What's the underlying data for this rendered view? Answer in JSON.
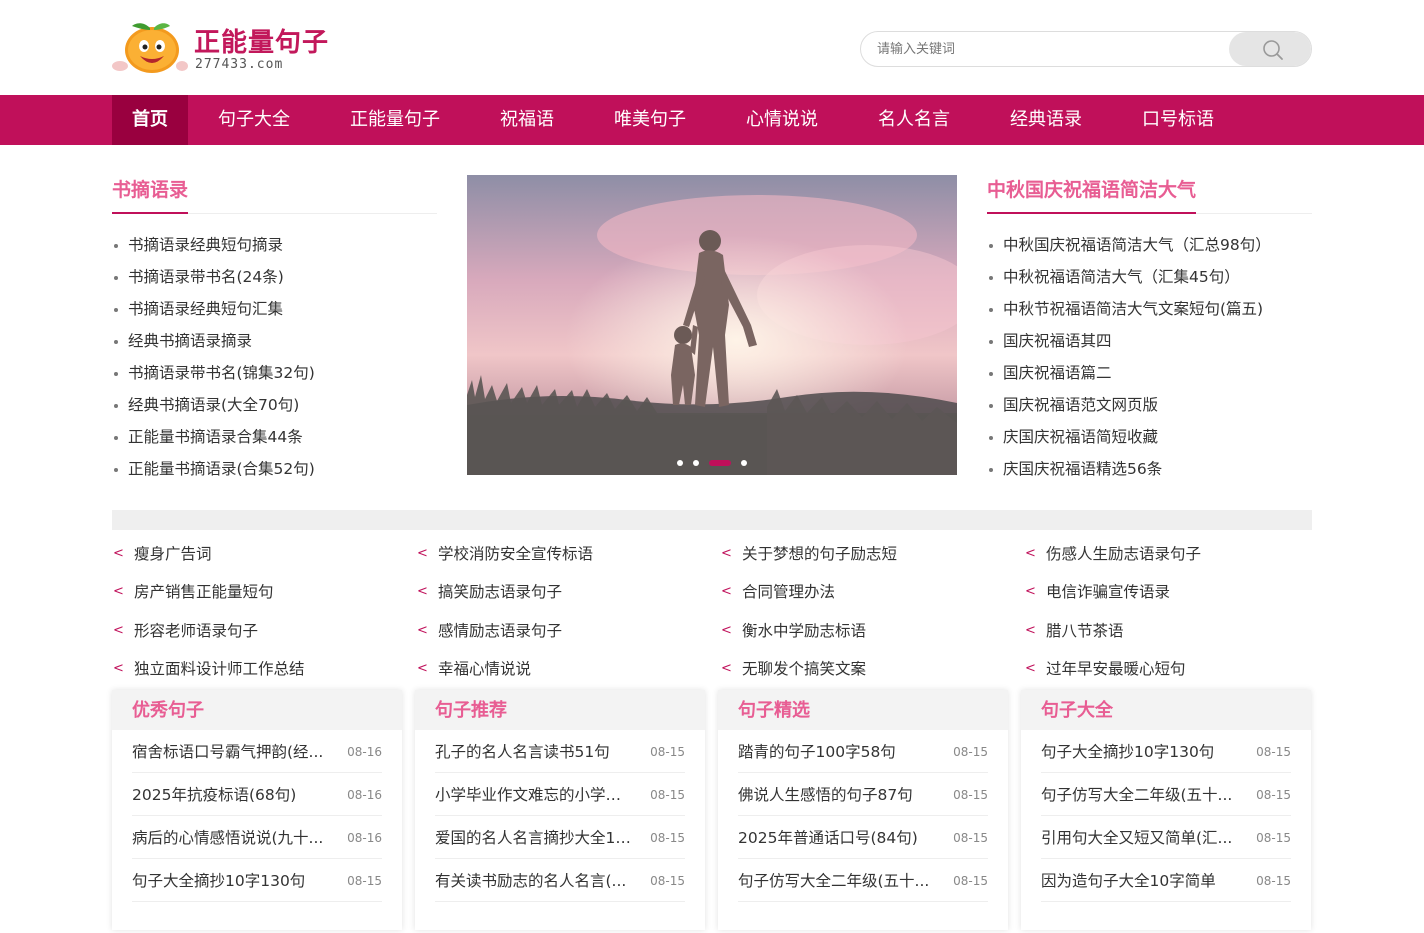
{
  "site": {
    "title": "正能量句子",
    "domain": "277433.com"
  },
  "search": {
    "placeholder": "请输入关键词"
  },
  "nav": {
    "items": [
      "首页",
      "句子大全",
      "正能量句子",
      "祝福语",
      "唯美句子",
      "心情说说",
      "名人名言",
      "经典语录",
      "口号标语"
    ]
  },
  "left_section": {
    "title": "书摘语录",
    "items": [
      "书摘语录经典短句摘录",
      "书摘语录带书名(24条)",
      "书摘语录经典短句汇集",
      "经典书摘语录摘录",
      "书摘语录带书名(锦集32句)",
      "经典书摘语录(大全70句)",
      "正能量书摘语录合集44条",
      "正能量书摘语录(合集52句)"
    ]
  },
  "right_section": {
    "title": "中秋国庆祝福语简洁大气",
    "items": [
      "中秋国庆祝福语简洁大气（汇总98句）",
      "中秋祝福语简洁大气（汇集45句）",
      "中秋节祝福语简洁大气文案短句(篇五)",
      "国庆祝福语其四",
      "国庆祝福语篇二",
      "国庆祝福语范文网页版",
      "庆国庆祝福语简短收藏",
      "庆国庆祝福语精选56条"
    ]
  },
  "slider": {
    "active_index": 2,
    "dot_count": 4
  },
  "tags": [
    "瘦身广告词",
    "学校消防安全宣传标语",
    "关于梦想的句子励志短",
    "伤感人生励志语录句子",
    "房产销售正能量短句",
    "搞笑励志语录句子",
    "合同管理办法",
    "电信诈骗宣传语录",
    "形容老师语录句子",
    "感情励志语录句子",
    "衡水中学励志标语",
    "腊八节茶语",
    "独立面料设计师工作总结",
    "幸福心情说说",
    "无聊发个搞笑文案",
    "过年早安最暖心短句"
  ],
  "panels": [
    {
      "title": "优秀句子",
      "items": [
        {
          "text": "宿舍标语口号霸气押韵(经...",
          "date": "08-16"
        },
        {
          "text": "2025年抗疫标语(68句)",
          "date": "08-16"
        },
        {
          "text": "病后的心情感悟说说(九十...",
          "date": "08-16"
        },
        {
          "text": "句子大全摘抄10字130句",
          "date": "08-15"
        }
      ]
    },
    {
      "title": "句子推荐",
      "items": [
        {
          "text": "孔子的名人名言读书51句",
          "date": "08-15"
        },
        {
          "text": "小学毕业作文难忘的小学生...",
          "date": "08-15"
        },
        {
          "text": "爱国的名人名言摘抄大全15...",
          "date": "08-15"
        },
        {
          "text": "有关读书励志的名人名言(...",
          "date": "08-15"
        }
      ]
    },
    {
      "title": "句子精选",
      "items": [
        {
          "text": "踏青的句子100字58句",
          "date": "08-15"
        },
        {
          "text": "佛说人生感悟的句子87句",
          "date": "08-15"
        },
        {
          "text": "2025年普通话口号(84句)",
          "date": "08-15"
        },
        {
          "text": "句子仿写大全二年级(五十...",
          "date": "08-15"
        }
      ]
    },
    {
      "title": "句子大全",
      "items": [
        {
          "text": "句子大全摘抄10字130句",
          "date": "08-15"
        },
        {
          "text": "句子仿写大全二年级(五十...",
          "date": "08-15"
        },
        {
          "text": "引用句大全又短又简单(汇...",
          "date": "08-15"
        },
        {
          "text": "因为造句子大全10字简单",
          "date": "08-15"
        }
      ]
    }
  ],
  "colors": {
    "brand": "#c0105a",
    "nav_active": "#99003f",
    "title_pink": "#e85d93"
  }
}
